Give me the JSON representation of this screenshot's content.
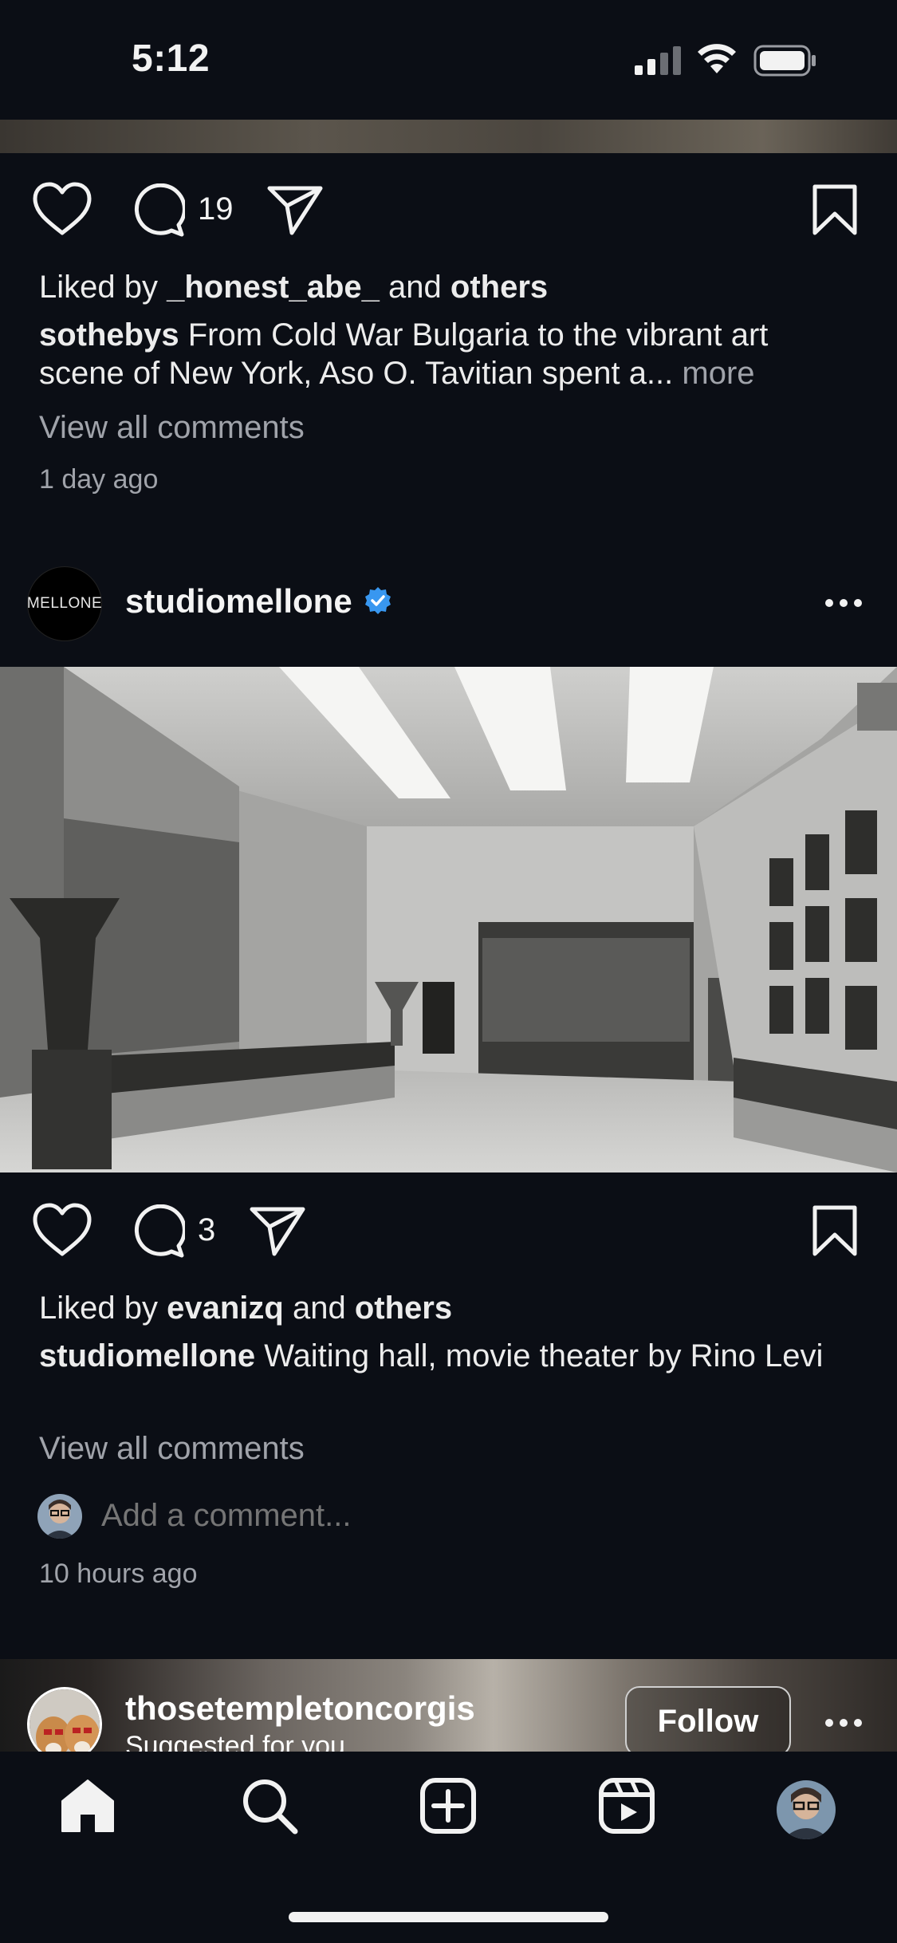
{
  "status_bar": {
    "time": "5:12"
  },
  "previous_post": {
    "comment_count": "19",
    "liked_by_prefix": "Liked by",
    "liked_by_user": "_honest_abe_",
    "liked_by_and": "and",
    "liked_by_others": "others",
    "caption_user": "sothebys",
    "caption_text": "From Cold War Bulgaria to the vibrant art scene of New York, Aso O. Tavitian spent a...",
    "more_label": "more",
    "view_comments": "View all comments",
    "timestamp": "1 day ago"
  },
  "post": {
    "avatar_text": "MELLONE",
    "username": "studiomellone",
    "comment_count": "3",
    "liked_by_prefix": "Liked by",
    "liked_by_user": "evanizq",
    "liked_by_and": "and",
    "liked_by_others": "others",
    "caption_user": "studiomellone",
    "caption_text": "Waiting hall, movie theater by Rino Levi",
    "view_comments": "View all comments",
    "comment_placeholder": "Add a comment...",
    "timestamp": "10 hours ago"
  },
  "suggested_post": {
    "username": "thosetempletoncorgis",
    "label": "Suggested for you",
    "follow_label": "Follow"
  },
  "tabs": [
    {
      "name": "home",
      "icon": "home-icon"
    },
    {
      "name": "search",
      "icon": "search-icon"
    },
    {
      "name": "create",
      "icon": "add-post-icon"
    },
    {
      "name": "reels",
      "icon": "reels-icon"
    },
    {
      "name": "profile",
      "icon": "profile-avatar"
    }
  ],
  "colors": {
    "background": "#0b0e15",
    "verified": "#3897f0",
    "muted_text": "#a0a3aa"
  }
}
